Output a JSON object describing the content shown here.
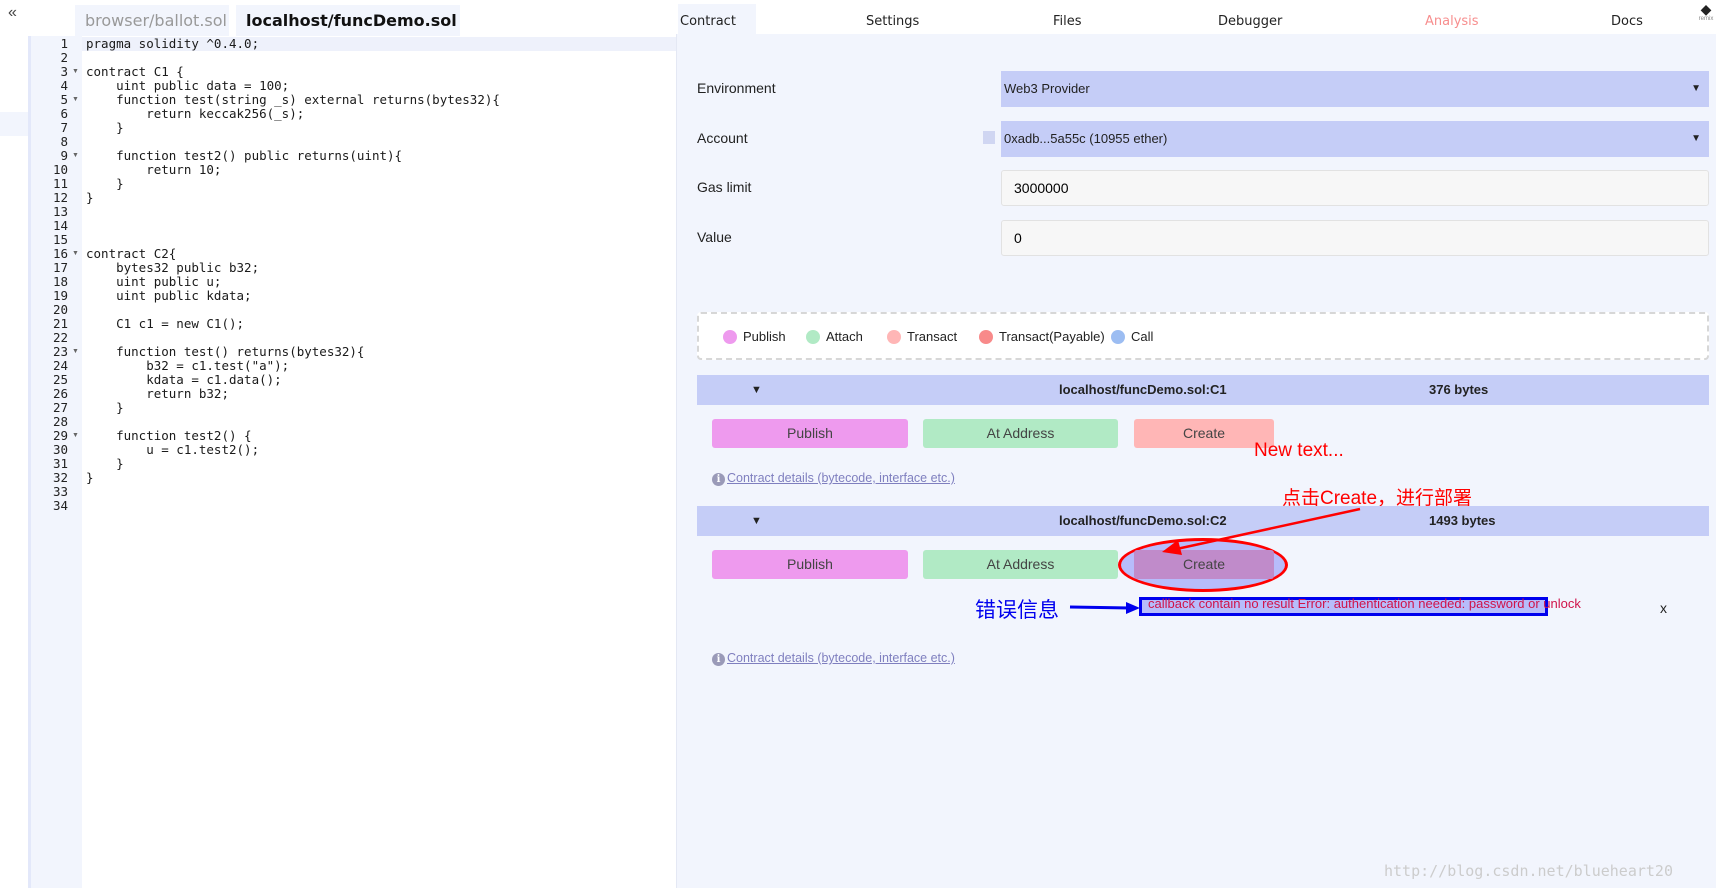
{
  "editor": {
    "collapse_label": "«",
    "tabs": [
      {
        "label": "browser/ballot.sol",
        "active": false
      },
      {
        "label": "localhost/funcDemo.sol",
        "active": true,
        "close": "✖"
      }
    ],
    "lines": [
      "pragma solidity ^0.4.0;",
      "",
      "contract C1 {",
      "    uint public data = 100;",
      "    function test(string _s) external returns(bytes32){",
      "        return keccak256(_s);",
      "    }",
      "",
      "    function test2() public returns(uint){",
      "        return 10;",
      "    }",
      "}",
      "",
      "",
      "",
      "contract C2{",
      "    bytes32 public b32;",
      "    uint public u;",
      "    uint public kdata;",
      "",
      "    C1 c1 = new C1();",
      "",
      "    function test() returns(bytes32){",
      "        b32 = c1.test(\"a\");",
      "        kdata = c1.data();",
      "        return b32;",
      "    }",
      "",
      "    function test2() {",
      "        u = c1.test2();",
      "    }",
      "}",
      "",
      ""
    ],
    "folded_lines": [
      3,
      5,
      9,
      16,
      23,
      29
    ]
  },
  "right_tabs": [
    "Contract",
    "Settings",
    "Files",
    "Debugger",
    "Analysis",
    "Docs"
  ],
  "logo_text": "remix",
  "colors": {
    "analysis_tab": "#f78e8e",
    "select_bg": "#c5cdf7",
    "publish": "#ee9aee",
    "attach": "#b1eac5",
    "transact": "#ffb6b6",
    "transact_payable": "#f88a8a",
    "call": "#9cbdf2",
    "create_pressed": "#c08bca",
    "annotation_red": "#ff0000",
    "annotation_blue": "#0000ee"
  },
  "form": {
    "environment": {
      "label": "Environment",
      "value": "Web3 Provider"
    },
    "account": {
      "label": "Account",
      "value": "0xadb...5a55c (10955 ether)"
    },
    "gas_limit": {
      "label": "Gas limit",
      "value": "3000000"
    },
    "value": {
      "label": "Value",
      "value": "0"
    }
  },
  "legend": [
    "Publish",
    "Attach",
    "Transact",
    "Transact(Payable)",
    "Call"
  ],
  "contracts": [
    {
      "name": "localhost/funcDemo.sol:C1",
      "size": "376 bytes",
      "buttons": [
        "Publish",
        "At Address",
        "Create"
      ],
      "details": "Contract details (bytecode, interface etc.)"
    },
    {
      "name": "localhost/funcDemo.sol:C2",
      "size": "1493 bytes",
      "buttons": [
        "Publish",
        "At Address",
        "Create"
      ],
      "details": "Contract details (bytecode, interface etc.)",
      "error": "callback contain no result Error: authentication needed: password or unlock",
      "error_close": "x"
    }
  ],
  "annotations": {
    "new_text": "New text...",
    "click_create": "点击Create，进行部署",
    "error_info": "错误信息"
  },
  "watermark": "http://blog.csdn.net/blueheart20"
}
